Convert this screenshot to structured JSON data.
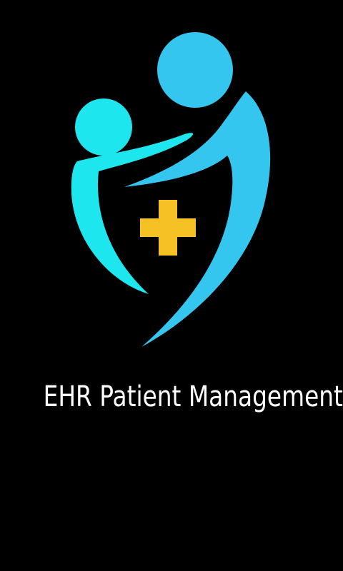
{
  "splash": {
    "title": "EHR Patient Management System",
    "logo_icon": "family-care-shield-cross-icon",
    "colors": {
      "background": "#000000",
      "child_figure": "#1EE6EE",
      "adult_figure": "#35C6F0",
      "cross": "#F5C125",
      "title_text": "#FFFFFF"
    }
  }
}
